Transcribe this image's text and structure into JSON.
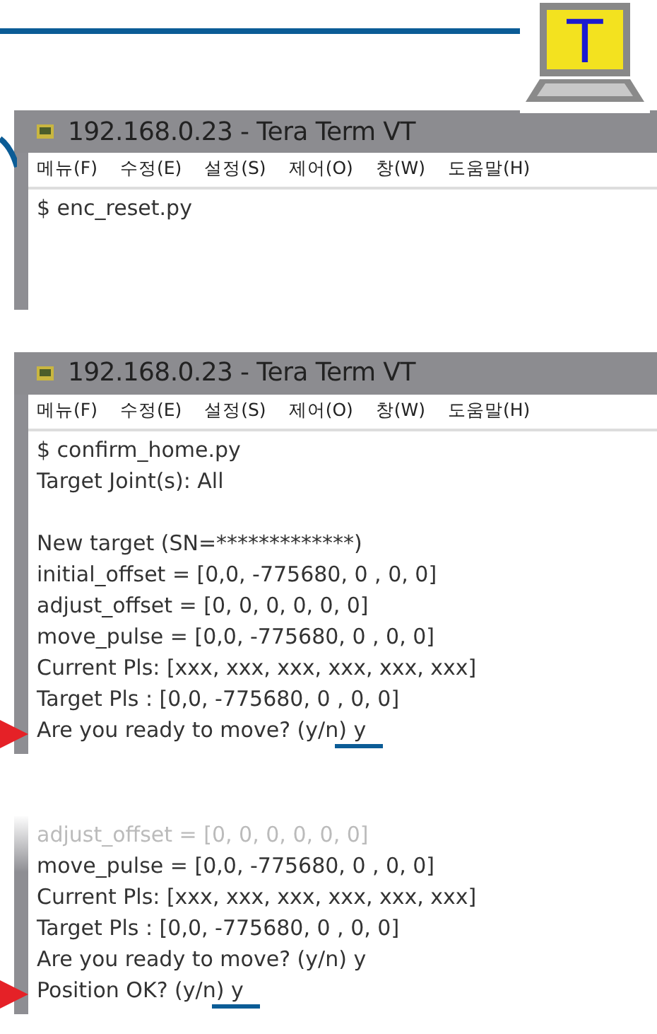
{
  "logo": {
    "letter": "T"
  },
  "windows": [
    {
      "title": "192.168.0.23 - Tera Term VT",
      "menu": [
        "메뉴(F)",
        "수정(E)",
        "설정(S)",
        "제어(O)",
        "창(W)",
        "도움말(H)"
      ],
      "lines": [
        {
          "kind": "text",
          "text": "$ enc_reset.py",
          "highlighted": false,
          "dimmed": false
        }
      ]
    },
    {
      "title": "192.168.0.23 - Tera Term VT",
      "menu": [
        "메뉴(F)",
        "수정(E)",
        "설정(S)",
        "제어(O)",
        "창(W)",
        "도움말(H)"
      ],
      "lines": [
        {
          "kind": "text",
          "text": "$ confirm_home.py",
          "highlighted": false,
          "dimmed": false
        },
        {
          "kind": "text",
          "text": "Target Joint(s): All",
          "highlighted": false,
          "dimmed": false
        },
        {
          "kind": "blank"
        },
        {
          "kind": "text",
          "text": "New target (SN=*************)",
          "highlighted": false,
          "dimmed": false
        },
        {
          "kind": "text",
          "text": "initial_offset = [0,0, -775680, 0 , 0, 0]",
          "highlighted": false,
          "dimmed": false
        },
        {
          "kind": "text",
          "text": "adjust_offset = [0, 0, 0, 0, 0, 0]",
          "highlighted": false,
          "dimmed": false
        },
        {
          "kind": "text",
          "text": "move_pulse = [0,0, -775680, 0 , 0, 0]",
          "highlighted": false,
          "dimmed": false
        },
        {
          "kind": "text",
          "text": "Current Pls: [xxx, xxx, xxx, xxx, xxx, xxx]",
          "highlighted": false,
          "dimmed": false
        },
        {
          "kind": "text",
          "text": "Target Pls : [0,0, -775680, 0 , 0, 0]",
          "highlighted": false,
          "dimmed": false
        },
        {
          "kind": "text",
          "text": "Are you ready to move? (y/n) y",
          "highlighted": true,
          "dimmed": false
        }
      ]
    },
    {
      "lines": [
        {
          "kind": "text",
          "text": "adjust_offset = [0, 0, 0, 0, 0, 0]",
          "highlighted": false,
          "dimmed": true
        },
        {
          "kind": "text",
          "text": "move_pulse = [0,0, -775680, 0 , 0, 0]",
          "highlighted": false,
          "dimmed": false
        },
        {
          "kind": "text",
          "text": "Current Pls: [xxx, xxx, xxx, xxx, xxx, xxx]",
          "highlighted": false,
          "dimmed": false
        },
        {
          "kind": "text",
          "text": "Target Pls : [0,0, -775680, 0 , 0, 0]",
          "highlighted": false,
          "dimmed": false
        },
        {
          "kind": "text",
          "text": "Are you ready to move? (y/n) y",
          "highlighted": false,
          "dimmed": false
        },
        {
          "kind": "text",
          "text": "Position OK? (y/n) y",
          "highlighted": true,
          "dimmed": false
        }
      ]
    }
  ]
}
